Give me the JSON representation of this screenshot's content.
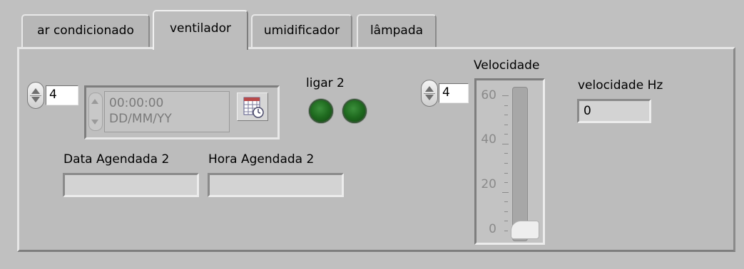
{
  "tabs": [
    {
      "label": "ar condicionado",
      "active": false
    },
    {
      "label": "ventilador",
      "active": true
    },
    {
      "label": "umidificador",
      "active": false
    },
    {
      "label": "lâmpada",
      "active": false
    }
  ],
  "left_numeric": {
    "value": "4"
  },
  "timestamp": {
    "time": "00:00:00",
    "date": "DD/MM/YY"
  },
  "ligar": {
    "label": "ligar 2"
  },
  "data_agendada": {
    "label": "Data Agendada 2",
    "value": ""
  },
  "hora_agendada": {
    "label": "Hora Agendada 2",
    "value": ""
  },
  "velocidade": {
    "label": "Velocidade",
    "numeric_value": "4",
    "slider_value": 0,
    "scale_ticks": [
      "60",
      "40",
      "20",
      "0"
    ]
  },
  "velocidade_hz": {
    "label": "velocidade Hz",
    "value": "0"
  },
  "icons": {
    "calendar_button": "calendar-clock-icon",
    "led_1": "led-indicator-icon",
    "led_2": "led-indicator-icon"
  },
  "colors": {
    "background": "#c0c0c0",
    "led_green": "#1f6a1f"
  }
}
